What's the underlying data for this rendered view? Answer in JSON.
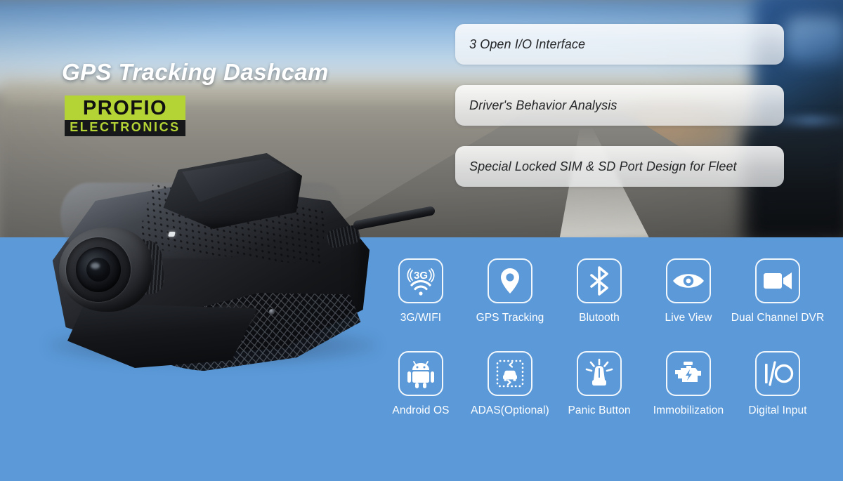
{
  "headline": "GPS Tracking Dashcam",
  "logo": {
    "word": "PROFIO",
    "sub": "ELECTRONICS",
    "green": "#b4d335",
    "dark": "#17181a"
  },
  "colors": {
    "panel_blue": "#5b99d8",
    "headline_white": "#ffffff",
    "pill_text": "#242628"
  },
  "pills": [
    {
      "text": "3 Open I/O Interface"
    },
    {
      "text": "Driver's Behavior Analysis"
    },
    {
      "text": "Special Locked SIM & SD Port Design for Fleet"
    }
  ],
  "product": {
    "name": "gps-tracking-dashcam-device"
  },
  "features": {
    "row1": [
      {
        "label": "3G/WIFI",
        "icon": "3g-wifi-icon"
      },
      {
        "label": "GPS Tracking",
        "icon": "location-pin-icon"
      },
      {
        "label": "Blutooth",
        "icon": "bluetooth-icon"
      },
      {
        "label": "Live View",
        "icon": "eye-icon"
      },
      {
        "label": "Dual Channel DVR",
        "icon": "video-camera-icon"
      }
    ],
    "row2": [
      {
        "label": "Android OS",
        "icon": "android-robot-icon"
      },
      {
        "label": "ADAS(Optional)",
        "icon": "adas-car-lane-icon"
      },
      {
        "label": "Panic Button",
        "icon": "siren-alarm-icon"
      },
      {
        "label": "Immobilization",
        "icon": "engine-bolt-icon"
      },
      {
        "label": "Digital Input",
        "icon": "io-text-icon"
      }
    ]
  }
}
